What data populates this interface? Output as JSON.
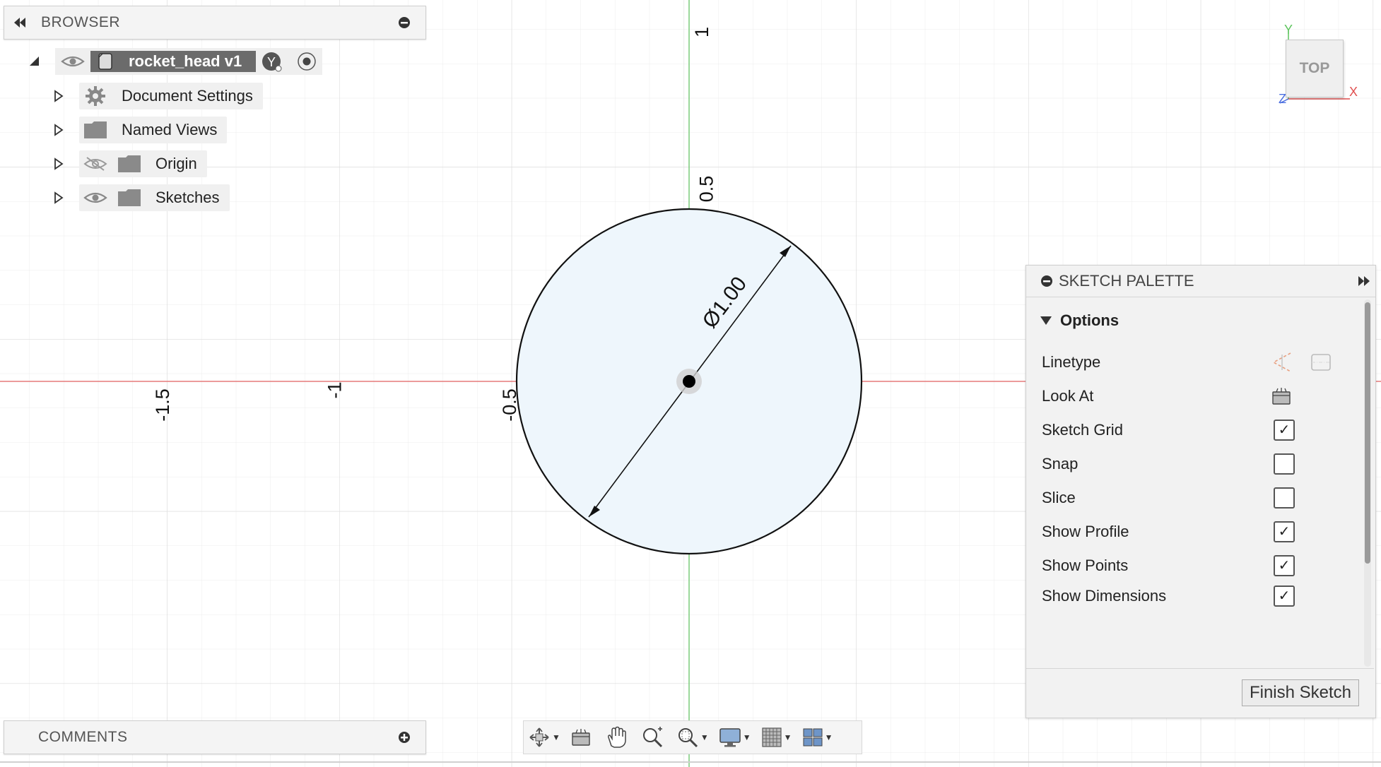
{
  "browser": {
    "title": "BROWSER",
    "root": {
      "label": "rocket_head v1"
    },
    "items": [
      {
        "label": "Document Settings"
      },
      {
        "label": "Named Views"
      },
      {
        "label": "Origin"
      },
      {
        "label": "Sketches"
      }
    ]
  },
  "comments": {
    "title": "COMMENTS"
  },
  "canvas": {
    "x_ticks": [
      "-1.5",
      "-1",
      "-0.5"
    ],
    "y_ticks": [
      "1",
      "0.5"
    ],
    "dimension_label": "Ø1.00"
  },
  "viewcube": {
    "face": "TOP",
    "axis_x": "X",
    "axis_y": "Y",
    "axis_z": "Z"
  },
  "sketch_palette": {
    "title": "SKETCH PALETTE",
    "section": "Options",
    "rows": [
      {
        "label": "Linetype"
      },
      {
        "label": "Look At"
      },
      {
        "label": "Sketch Grid",
        "checked": true
      },
      {
        "label": "Snap",
        "checked": false
      },
      {
        "label": "Slice",
        "checked": false
      },
      {
        "label": "Show Profile",
        "checked": true
      },
      {
        "label": "Show Points",
        "checked": true
      },
      {
        "label": "Show Dimensions",
        "checked": true
      }
    ],
    "finish_button": "Finish Sketch"
  },
  "colors": {
    "x_axis": "#e06060",
    "y_axis": "#60c060",
    "profile_fill": "#eef6fc",
    "grid": "#e6e6e6"
  },
  "toolbar": {
    "icons": [
      "orbit-icon",
      "look-at-icon",
      "pan-icon",
      "zoom-icon",
      "zoom-window-icon",
      "display-settings-icon",
      "grid-settings-icon",
      "viewports-icon"
    ]
  }
}
